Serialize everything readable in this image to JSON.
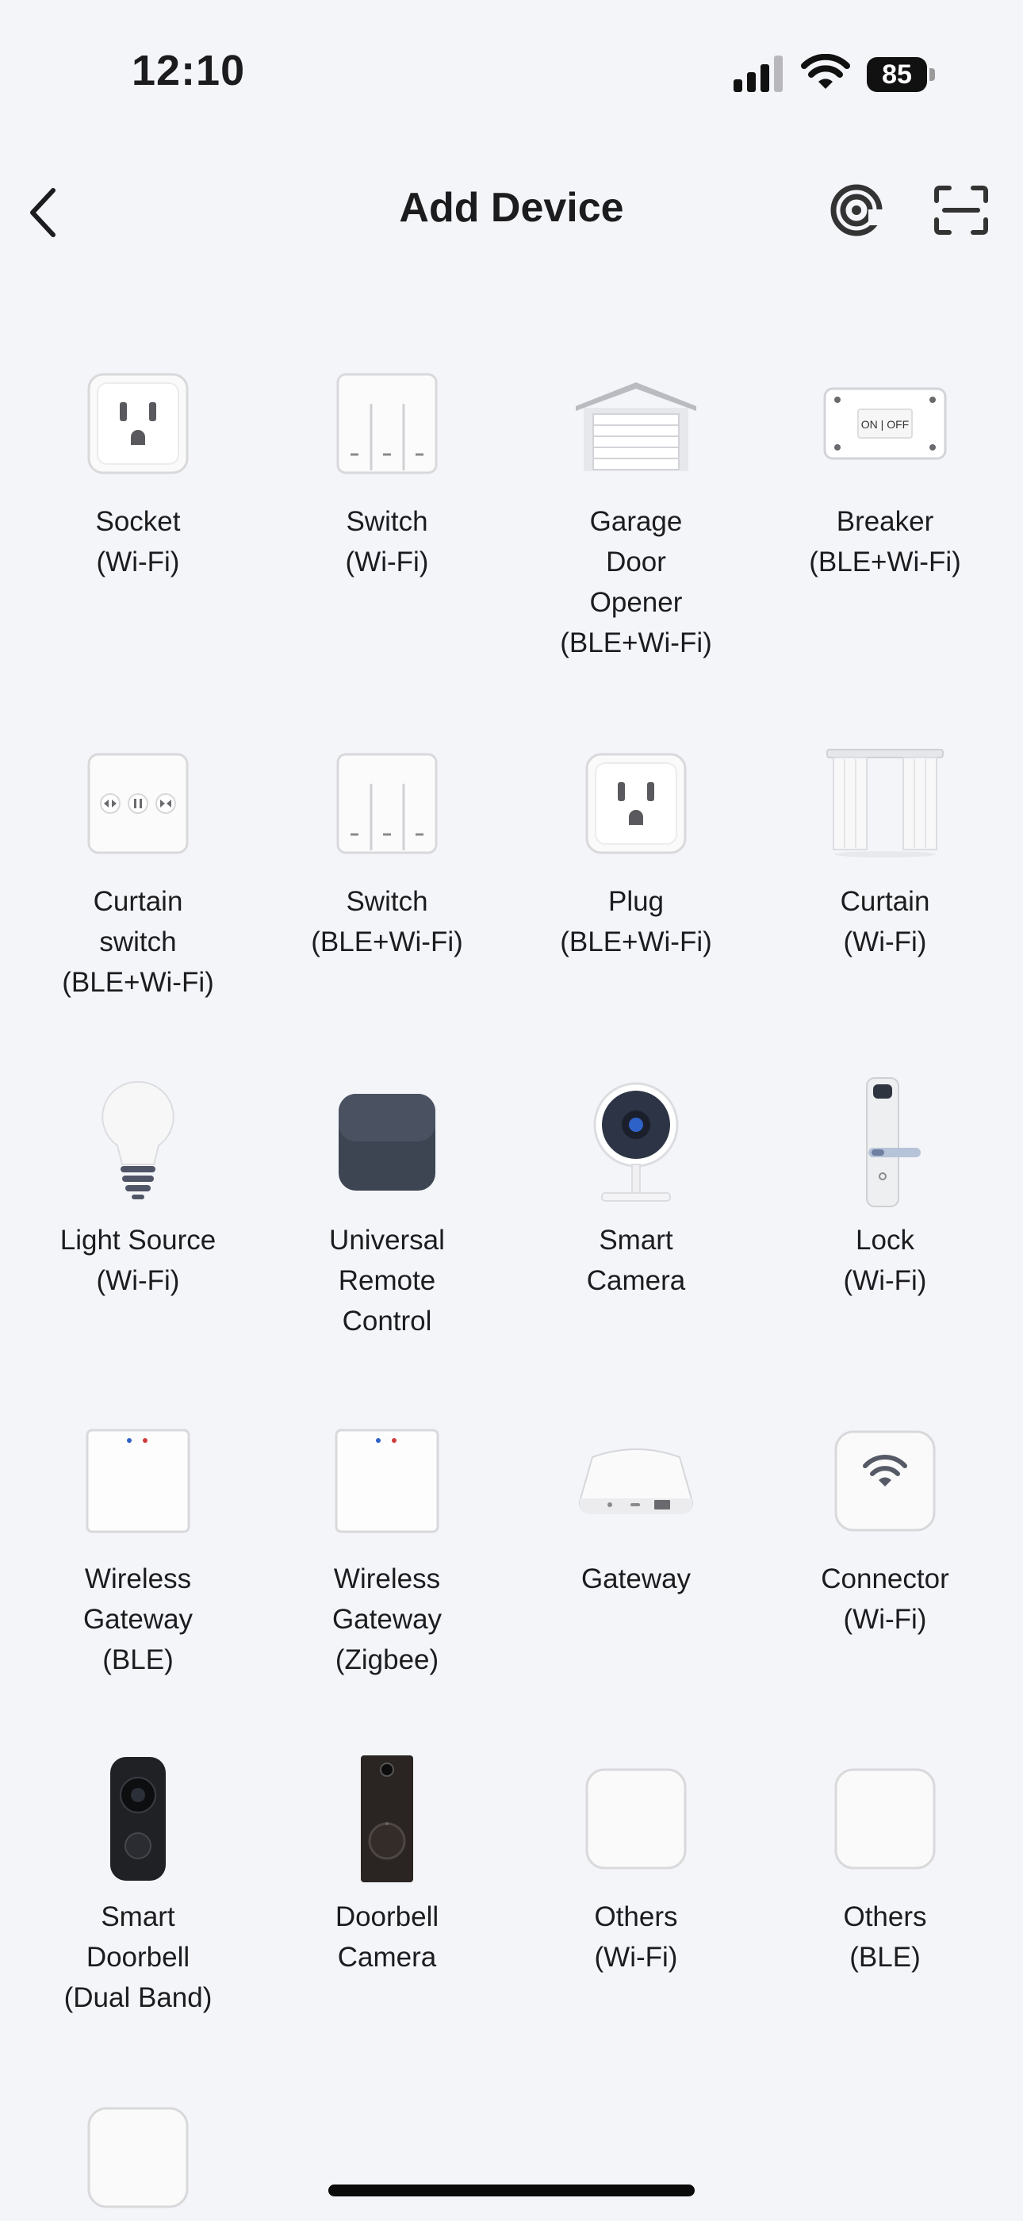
{
  "status_bar": {
    "time": "12:10",
    "battery": "85"
  },
  "header": {
    "title": "Add Device"
  },
  "devices": [
    {
      "label": "Socket\n(Wi-Fi)",
      "icon": "socket-icon"
    },
    {
      "label": "Switch\n(Wi-Fi)",
      "icon": "switch-icon"
    },
    {
      "label": "Garage\nDoor\nOpener\n(BLE+Wi-Fi)",
      "icon": "garage-door-icon"
    },
    {
      "label": "Breaker\n(BLE+Wi-Fi)",
      "icon": "breaker-icon",
      "icon_text": "ON | OFF"
    },
    {
      "label": "Curtain\nswitch\n(BLE+Wi-Fi)",
      "icon": "curtain-switch-icon"
    },
    {
      "label": "Switch\n(BLE+Wi-Fi)",
      "icon": "switch-icon"
    },
    {
      "label": "Plug\n(BLE+Wi-Fi)",
      "icon": "plug-icon"
    },
    {
      "label": "Curtain\n(Wi-Fi)",
      "icon": "curtain-icon"
    },
    {
      "label": "Light Source\n(Wi-Fi)",
      "icon": "light-bulb-icon"
    },
    {
      "label": "Universal\nRemote\nControl",
      "icon": "remote-control-icon"
    },
    {
      "label": "Smart\nCamera",
      "icon": "camera-icon"
    },
    {
      "label": "Lock\n(Wi-Fi)",
      "icon": "lock-icon"
    },
    {
      "label": "Wireless\nGateway\n(BLE)",
      "icon": "wireless-gateway-icon"
    },
    {
      "label": "Wireless\nGateway\n(Zigbee)",
      "icon": "wireless-gateway-icon"
    },
    {
      "label": "Gateway",
      "icon": "gateway-icon"
    },
    {
      "label": "Connector\n(Wi-Fi)",
      "icon": "connector-icon"
    },
    {
      "label": "Smart\nDoorbell\n(Dual Band)",
      "icon": "smart-doorbell-icon"
    },
    {
      "label": "Doorbell\nCamera",
      "icon": "doorbell-camera-icon"
    },
    {
      "label": "Others\n(Wi-Fi)",
      "icon": "generic-device-icon"
    },
    {
      "label": "Others\n(BLE)",
      "icon": "generic-device-icon"
    },
    {
      "label": "",
      "icon": "generic-device-icon"
    }
  ]
}
